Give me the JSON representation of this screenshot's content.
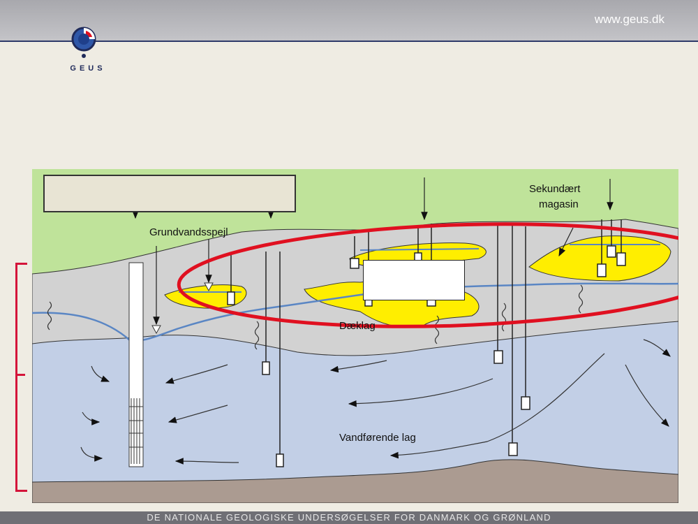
{
  "header": {
    "url": "www.geus.dk"
  },
  "logo": {
    "text": "GEUS",
    "icon": "geus-logo-icon"
  },
  "footer": {
    "text": "DE NATIONALE GEOLOGISKE UNDERSØGELSER FOR DANMARK OG GRØNLAND"
  },
  "diagram": {
    "labels": {
      "groundwater_table": "Grundvandsspejl",
      "secondary_reservoir_line1": "Sekundært",
      "secondary_reservoir_line2": "magasin",
      "cover_layer": "Dæklag",
      "aquifer": "Vandførende lag"
    },
    "colors": {
      "surface": "#bfe39a",
      "cover": "#d2d2d2",
      "aquifer": "#c2cfe6",
      "bedrock": "#ab9b91",
      "sand_lens": "#ffee00",
      "water_line": "#5a86c4",
      "highlight": "#e01020"
    }
  }
}
